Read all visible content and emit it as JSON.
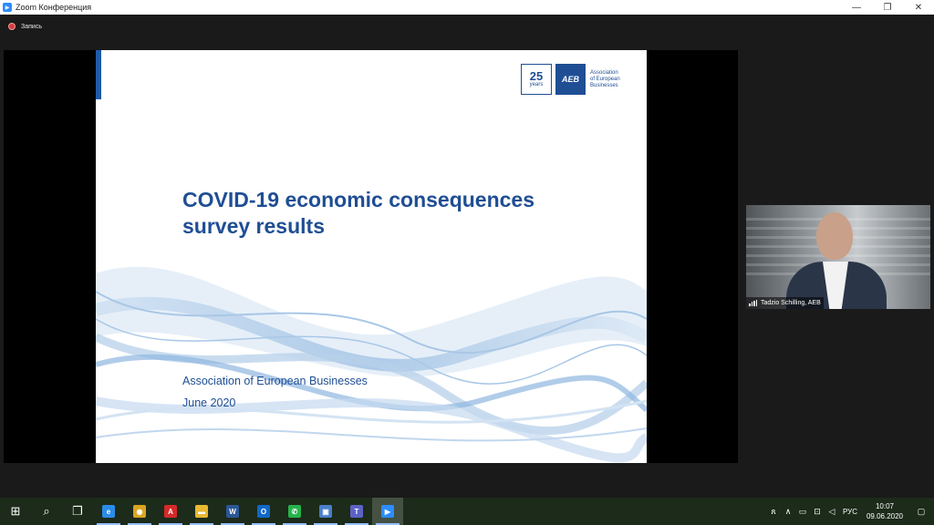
{
  "window": {
    "title": "Zoom Конференция",
    "controls": [
      "—",
      "❐",
      "✕"
    ]
  },
  "recording": {
    "label": "Запись"
  },
  "slide": {
    "title_line1": "COVID-19 economic consequences",
    "title_line2": "survey results",
    "organization": "Association of European Businesses",
    "date": "June 2020",
    "logo": {
      "years_number": "25",
      "years_label": "years",
      "badge": "AEB",
      "text_line1": "Association",
      "text_line2": "of European",
      "text_line3": "Businesses"
    },
    "accent_color": "#1f4e94"
  },
  "participant": {
    "name": "Tadzio Schilling, AEB"
  },
  "taskbar": {
    "apps": [
      {
        "name": "start-icon",
        "glyph": "⊞",
        "color": "#ffffff"
      },
      {
        "name": "search-icon",
        "glyph": "⌕",
        "color": "#ffffff"
      },
      {
        "name": "task-view-icon",
        "glyph": "❐",
        "color": "#ffffff"
      },
      {
        "name": "edge-icon",
        "glyph": "e",
        "color": "#2b8be8"
      },
      {
        "name": "chrome-icon",
        "glyph": "◉",
        "color": "#d9a520"
      },
      {
        "name": "acrobat-icon",
        "glyph": "A",
        "color": "#d42a2a"
      },
      {
        "name": "file-explorer-icon",
        "glyph": "▬",
        "color": "#e8b931"
      },
      {
        "name": "word-icon",
        "glyph": "W",
        "color": "#2b5797"
      },
      {
        "name": "outlook-icon",
        "glyph": "O",
        "color": "#1168c7"
      },
      {
        "name": "whatsapp-icon",
        "glyph": "✆",
        "color": "#26b34c"
      },
      {
        "name": "network-app-icon",
        "glyph": "▣",
        "color": "#4a7fc9"
      },
      {
        "name": "teams-icon",
        "glyph": "T",
        "color": "#5c62c5"
      },
      {
        "name": "zoom-icon",
        "glyph": "▶",
        "color": "#2d8cff"
      }
    ],
    "tray": {
      "icons": [
        "person-icon",
        "chevron-up-icon",
        "battery-icon",
        "network-icon",
        "volume-icon"
      ],
      "language": "РУС",
      "time": "10:07",
      "date": "09.06.2020"
    }
  }
}
